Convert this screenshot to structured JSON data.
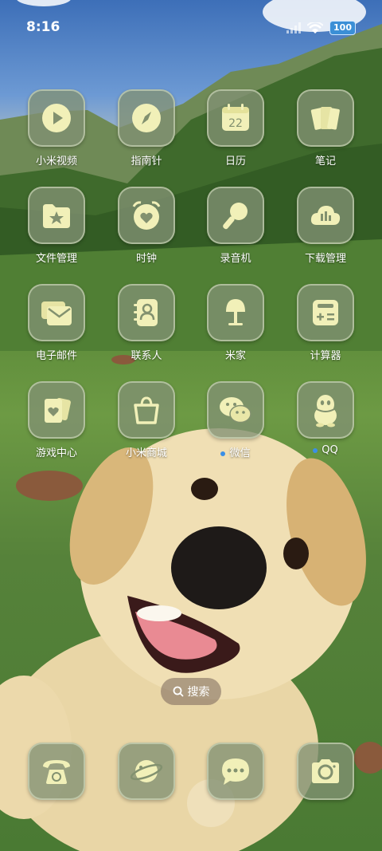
{
  "status_bar": {
    "time": "8:16",
    "battery": "100"
  },
  "apps": [
    {
      "label": "小米视频",
      "icon": "play-icon",
      "badge": false
    },
    {
      "label": "指南针",
      "icon": "compass-icon",
      "badge": false
    },
    {
      "label": "日历",
      "icon": "calendar-icon",
      "day": "22",
      "badge": false
    },
    {
      "label": "笔记",
      "icon": "notes-icon",
      "badge": false
    },
    {
      "label": "文件管理",
      "icon": "folder-star-icon",
      "badge": false
    },
    {
      "label": "时钟",
      "icon": "alarm-clock-icon",
      "badge": false
    },
    {
      "label": "录音机",
      "icon": "microphone-icon",
      "badge": false
    },
    {
      "label": "下载管理",
      "icon": "cloud-download-icon",
      "badge": false
    },
    {
      "label": "电子邮件",
      "icon": "mail-icon",
      "badge": false
    },
    {
      "label": "联系人",
      "icon": "contacts-icon",
      "badge": false
    },
    {
      "label": "米家",
      "icon": "lamp-icon",
      "badge": false
    },
    {
      "label": "计算器",
      "icon": "calculator-icon",
      "badge": false
    },
    {
      "label": "游戏中心",
      "icon": "game-card-icon",
      "badge": false
    },
    {
      "label": "小米商城",
      "icon": "shopping-bag-icon",
      "badge": false
    },
    {
      "label": "微信",
      "icon": "wechat-icon",
      "badge": true
    },
    {
      "label": "QQ",
      "icon": "penguin-icon",
      "badge": true
    }
  ],
  "search": {
    "label": "搜索"
  },
  "dock": [
    {
      "icon": "phone-icon"
    },
    {
      "icon": "browser-planet-icon"
    },
    {
      "icon": "messages-icon"
    },
    {
      "icon": "camera-icon"
    }
  ],
  "colors": {
    "icon_glyph": "#f1f0b8",
    "tile": "#82916f",
    "badge": "#3b8fe6"
  }
}
